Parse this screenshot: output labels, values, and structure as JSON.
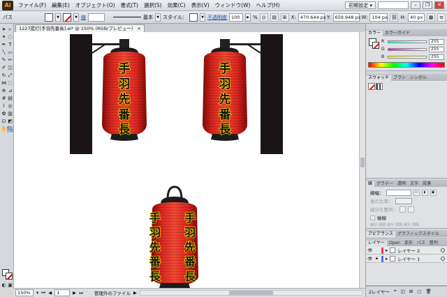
{
  "menubar": {
    "logo": "Ai",
    "items": [
      "ファイル(F)",
      "編集(E)",
      "オブジェクト(O)",
      "書式(T)",
      "選択(S)",
      "効果(C)",
      "表示(V)",
      "ウィンドウ(W)",
      "ヘルプ(H)"
    ],
    "workspace": "初期設定 ▾"
  },
  "controlbar": {
    "object_type": "パス",
    "stroke_link": "線",
    "stroke_style": "基本",
    "style_label": "スタイル：",
    "opacity_link": "不透明度",
    "opacity_value": "100",
    "opacity_unit": "%",
    "x_label": "X:",
    "x_value": "470.644 px",
    "y_label": "Y:",
    "y_value": "659.948 px",
    "w_label": "W:",
    "w_value": "104 px",
    "h_label": "H:",
    "h_value": "40 px"
  },
  "document": {
    "tab_title": "1227提灯[手羽先番長].ai* @ 150% (RGB/プレビュー)",
    "tab_close": "×",
    "lantern_text": [
      "手",
      "羽",
      "先",
      "番",
      "長"
    ]
  },
  "statusbar": {
    "zoom": "150%",
    "page": "1",
    "message": "管理外のファイル"
  },
  "panels": {
    "color_tabs": [
      "カラー",
      "カラーガイド"
    ],
    "color_sliders": [
      {
        "letter": "R",
        "value": "255",
        "gradient": "#ff0000"
      },
      {
        "letter": "G",
        "value": "255",
        "gradient": "#00d8a0"
      },
      {
        "letter": "B",
        "value": "255",
        "gradient": "#3050ff"
      }
    ],
    "swatch_tabs": [
      "スウォッチ",
      "ブラシ",
      "シンボル"
    ],
    "stroke_tabs": [
      "線",
      "グラデー",
      "透明",
      "文字",
      "段落"
    ],
    "stroke_weight_label": "線幅：",
    "stroke_weight_value": "",
    "stroke_rows_dim": [
      "角の比率：",
      "線分を整列："
    ],
    "dashed_label": "破線",
    "dash_fields": [
      "線分",
      "間隔",
      "線分",
      "間隔",
      "線分",
      "間隔"
    ],
    "appearance_tabs": [
      "アピアランス",
      "グラフィックスタイル"
    ],
    "layer_tabs": [
      "レイヤー",
      "Open",
      "変形",
      "パス",
      "整列"
    ],
    "layers": [
      {
        "name": "レイヤー 2",
        "color": "#ff3b3b"
      },
      {
        "name": "レイヤー 1",
        "color": "#4d6dff"
      }
    ],
    "layers_count": "2レイヤー"
  }
}
